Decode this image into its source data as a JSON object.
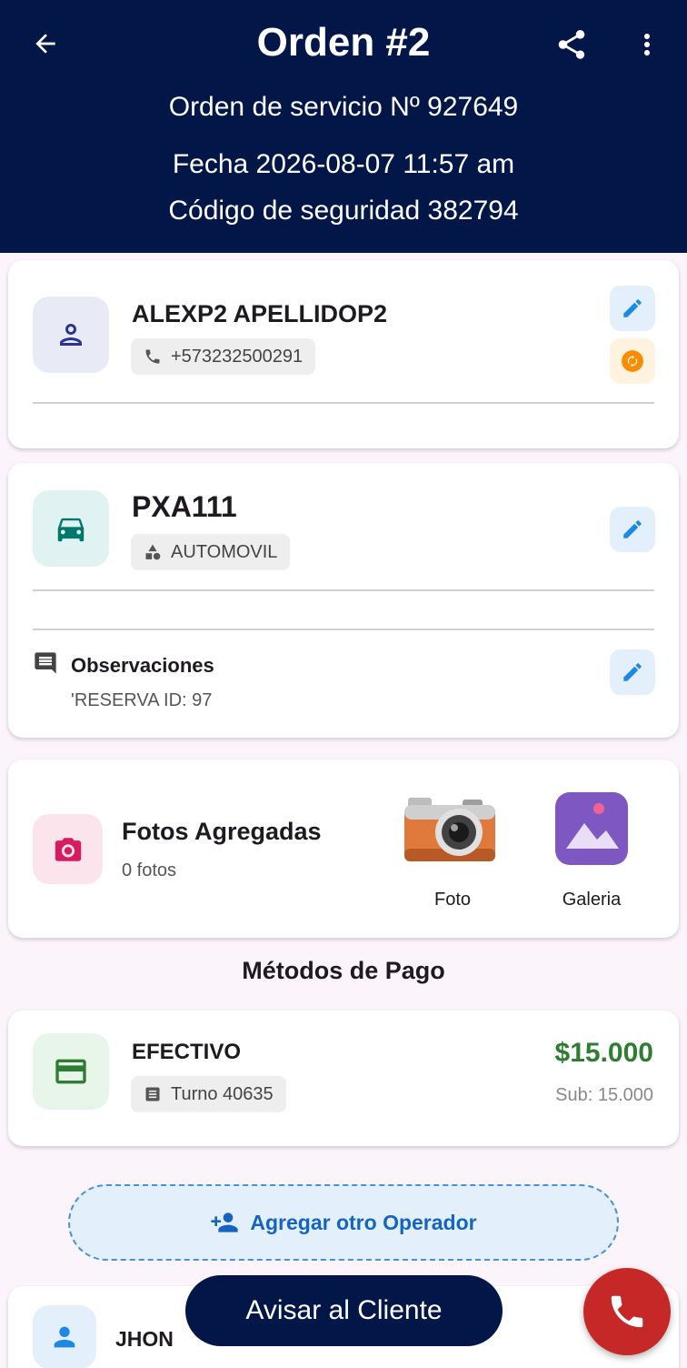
{
  "header": {
    "title": "Orden #2",
    "service_order": "Orden de servicio Nº 927649",
    "date": "Fecha 2026-08-07 11:57 am",
    "security_code": "Código de seguridad 382794"
  },
  "client": {
    "name": "ALEXP2 APELLIDOP2",
    "phone": "+573232500291"
  },
  "vehicle": {
    "plate": "PXA111",
    "type": "AUTOMOVIL"
  },
  "observations": {
    "label": "Observaciones",
    "text": "'RESERVA ID: 97"
  },
  "photos": {
    "title": "Fotos Agregadas",
    "count": "0 fotos",
    "photo_label": "Foto",
    "gallery_label": "Galeria"
  },
  "payment": {
    "section_title": "Métodos de Pago",
    "method": "EFECTIVO",
    "turno": "Turno 40635",
    "amount": "$15.000",
    "subtotal": "Sub: 15.000"
  },
  "operators": {
    "add_label": "Agregar otro Operador",
    "operator_name": "JHON"
  },
  "actions": {
    "notify_label": "Avisar al Cliente"
  },
  "colors": {
    "header_bg": "#021747",
    "edit_blue": "#1e88e5",
    "amount_green": "#2e7d32",
    "call_red": "#c62828"
  }
}
